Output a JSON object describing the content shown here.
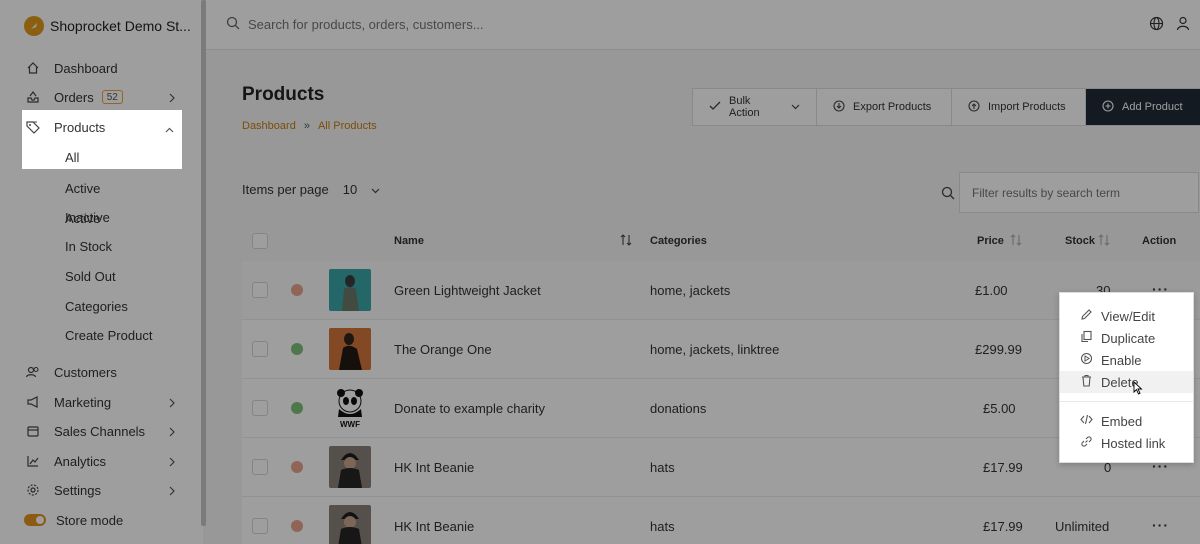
{
  "brand": {
    "name": "Shoprocket Demo St..."
  },
  "sidebar": {
    "items": [
      {
        "label": "Dashboard",
        "icon": "home-icon"
      },
      {
        "label": "Orders",
        "icon": "inbox-icon",
        "badge": "52"
      },
      {
        "label": "Products",
        "icon": "tag-icon"
      },
      {
        "label": "Customers",
        "icon": "users-icon"
      },
      {
        "label": "Marketing",
        "icon": "megaphone-icon"
      },
      {
        "label": "Sales Channels",
        "icon": "store-icon"
      },
      {
        "label": "Analytics",
        "icon": "chart-icon"
      },
      {
        "label": "Settings",
        "icon": "gear-icon"
      },
      {
        "label": "Store mode",
        "icon": "toggle-icon"
      }
    ],
    "product_sub": [
      "All",
      "Active",
      "Inactive",
      "In Stock",
      "Sold Out",
      "Categories",
      "Create Product"
    ]
  },
  "topbar": {
    "search_placeholder": "Search for products, orders, customers..."
  },
  "page": {
    "title": "Products",
    "breadcrumb": [
      "Dashboard",
      "»",
      "All Products"
    ]
  },
  "actions": {
    "bulk": "Bulk Action",
    "export": "Export Products",
    "import": "Import Products",
    "add": "Add Product"
  },
  "controls": {
    "items_per_page_label": "Items per page",
    "items_per_page_value": "10",
    "filter_placeholder": "Filter results by search term"
  },
  "table": {
    "headers": {
      "name": "Name",
      "categories": "Categories",
      "price": "Price",
      "stock": "Stock",
      "action": "Action"
    },
    "rows": [
      {
        "name": "Green Lightweight Jacket",
        "categories": "home, jackets",
        "price": "£1.00",
        "stock": "30",
        "status_color": "#e8a48d",
        "thumb_color": "#3aa6a8"
      },
      {
        "name": "The Orange One",
        "categories": "home, jackets, linktree",
        "price": "£299.99",
        "stock": "",
        "status_color": "#7fc27a",
        "thumb_color": "#d4773a"
      },
      {
        "name": "Donate to example charity",
        "categories": "donations",
        "price": "£5.00",
        "stock": "",
        "status_color": "#7fc27a",
        "thumb_color": "#ffffff"
      },
      {
        "name": "HK Int Beanie",
        "categories": "hats",
        "price": "£17.99",
        "stock": "0",
        "status_color": "#e8a48d",
        "thumb_color": "#5a5450"
      },
      {
        "name": "HK Int Beanie",
        "categories": "hats",
        "price": "£17.99",
        "stock": "Unlimited",
        "status_color": "#e8a48d",
        "thumb_color": "#5a5450"
      }
    ]
  },
  "menu": {
    "view_edit": "View/Edit",
    "duplicate": "Duplicate",
    "enable": "Enable",
    "delete": "Delete",
    "embed": "Embed",
    "hosted_link": "Hosted link"
  }
}
